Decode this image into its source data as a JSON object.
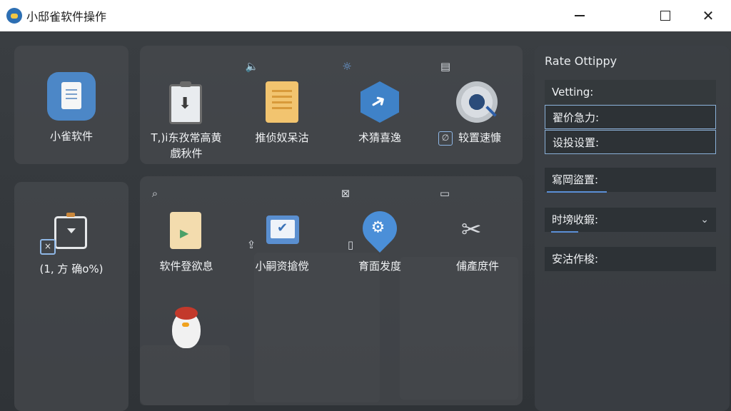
{
  "window": {
    "title": "小邸雀软件操作",
    "minimize": "—",
    "maximize": "☐",
    "close": "✕"
  },
  "tiles_top_left": {
    "label": "小雀软件"
  },
  "tiles_bottom_left": {
    "label": "(1, 方 确o%)"
  },
  "top_row": {
    "small_icons": [
      "speaker-icon",
      "sun-icon",
      "calculator-icon"
    ],
    "items": [
      {
        "label_line1": "T,)i东孜常高黄",
        "label_line2": "戲秋件"
      },
      {
        "label": "推侦奴呆沽"
      },
      {
        "label": "术猜喜逸"
      },
      {
        "label": "较置速慷"
      }
    ]
  },
  "bottom_row": {
    "small_icons": [
      "zoom-icon",
      "crossed-icon",
      "monitor-icon"
    ],
    "items": [
      {
        "label": "软件登欲息"
      },
      {
        "label": "小嗣资搶傥"
      },
      {
        "label": "育面发度"
      },
      {
        "label": "俌產庻件"
      }
    ]
  },
  "right_panel": {
    "title": "Rate Ottippy",
    "setting_header": "Vetting:",
    "rows": [
      {
        "label": "翟价急力:"
      },
      {
        "label": "设投设置:"
      },
      {
        "label": "寫岡盜置:"
      },
      {
        "label": "时塝收鍜:"
      },
      {
        "label": "安沽作梭:"
      }
    ],
    "chevron": "⌄",
    "accent": "#5b8fd6"
  }
}
